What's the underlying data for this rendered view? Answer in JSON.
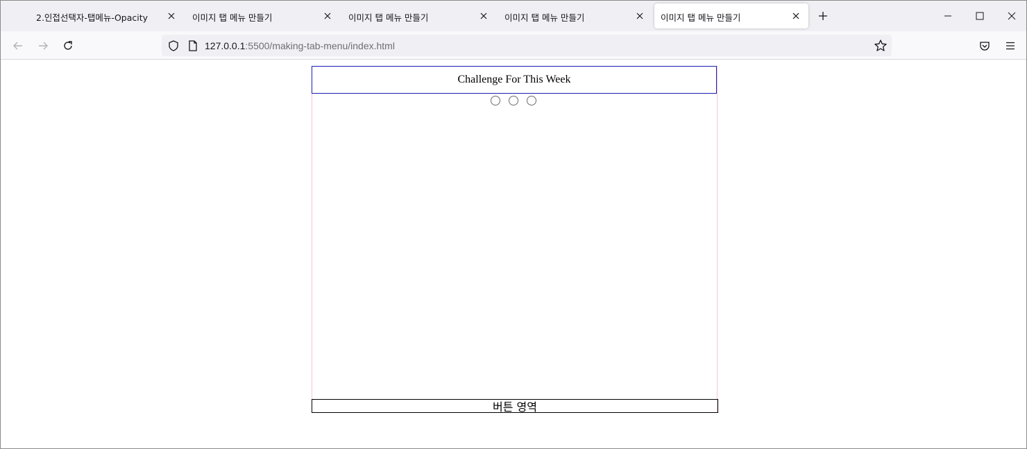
{
  "browser": {
    "tabs": [
      {
        "title": "2.인접선택자-탭메뉴-Opacity",
        "active": false
      },
      {
        "title": "이미지 탭 메뉴 만들기",
        "active": false
      },
      {
        "title": "이미지 탭 메뉴 만들기",
        "active": false
      },
      {
        "title": "이미지 탭 메뉴 만들기",
        "active": false
      },
      {
        "title": "이미지 탭 메뉴 만들기",
        "active": true
      }
    ],
    "url": {
      "host": "127.0.0.1",
      "path": ":5500/making-tab-menu/index.html"
    }
  },
  "page": {
    "title": "Challenge For This Week",
    "radio_count": 3,
    "button_area_label": "버튼 영역"
  },
  "colors": {
    "title_border": "#1c1cb4",
    "container_border": "#f4c6d6",
    "accent": "#15141a"
  }
}
